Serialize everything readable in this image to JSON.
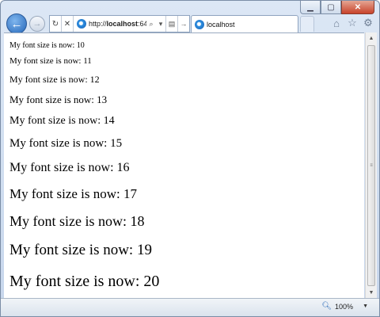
{
  "window": {
    "caption_buttons": [
      "minimize",
      "maximize",
      "close"
    ]
  },
  "nav": {
    "back_icon": "back-arrow-icon",
    "forward_icon": "forward-arrow-icon",
    "address": {
      "scheme": "http://",
      "host": "localhost",
      "port_fragment": ":64"
    },
    "refresh_glyph": "↻",
    "stop_glyph": "✕",
    "search_glyph": "⌕",
    "dropdown_glyph": "▾",
    "compat_glyph": "▤",
    "go_glyph": "→"
  },
  "tab": {
    "title": "localhost"
  },
  "toolbar_icons": [
    "home-icon",
    "star-icon",
    "gear-icon"
  ],
  "content": {
    "lines": [
      "My font size is now: 10",
      "My font size is now: 11",
      "My font size is now: 12",
      "My font size is now: 13",
      "My font size is now: 14",
      "My font size is now: 15",
      "My font size is now: 16",
      "My font size is now: 17",
      "My font size is now: 18",
      "My font size is now: 19",
      "My font size is now: 20"
    ]
  },
  "status": {
    "zoom": "100%"
  }
}
